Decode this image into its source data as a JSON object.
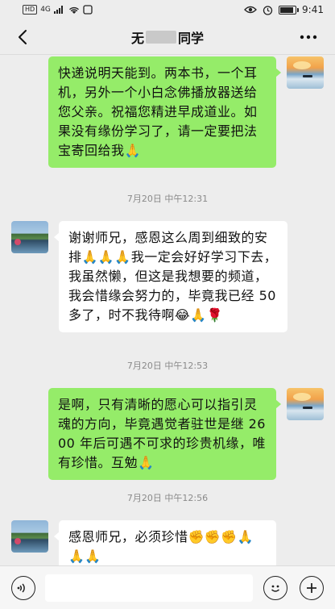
{
  "status_bar": {
    "network_label": "HD",
    "signal_label": "4G",
    "time": "9:41"
  },
  "header": {
    "title_prefix": "无",
    "title_suffix": "同学",
    "back_icon": "chevron-left-icon",
    "more_icon": "more-dots-icon"
  },
  "messages": [
    {
      "side": "right",
      "text": "快递说明天能到。两本书，一个耳机，另外一个小白念佛播放器送给您父亲。祝福您精进早成道业。如果没有缘份学习了，请一定要把法宝寄回给我🙏"
    },
    {
      "timestamp": "7月20日 中午12:31"
    },
    {
      "side": "left",
      "text": "谢谢师兄，感恩这么周到细致的安排🙏🙏🙏我一定会好好学习下去，我虽然懒，但这是我想要的频道，我会惜缘会努力的，毕竟我已经 50 多了，时不我待啊😂🙏🌹"
    },
    {
      "timestamp": "7月20日 中午12:53"
    },
    {
      "side": "right",
      "text": "是啊，只有清晰的愿心可以指引灵魂的方向，毕竟遇觉者驻世是继 2600 年后可遇不可求的珍贵机缘，唯有珍惜。互勉🙏"
    },
    {
      "timestamp": "7月20日 中午12:56"
    },
    {
      "side": "left",
      "text": "感恩师兄，必须珍惜✊✊✊🙏🙏🙏"
    }
  ],
  "input_bar": {
    "voice_icon": "voice-icon",
    "emoji_icon": "emoji-icon",
    "plus_icon": "plus-icon",
    "input_value": ""
  },
  "colors": {
    "bubble_sent": "#95ec69",
    "bubble_received": "#ffffff",
    "background": "#ededed"
  }
}
